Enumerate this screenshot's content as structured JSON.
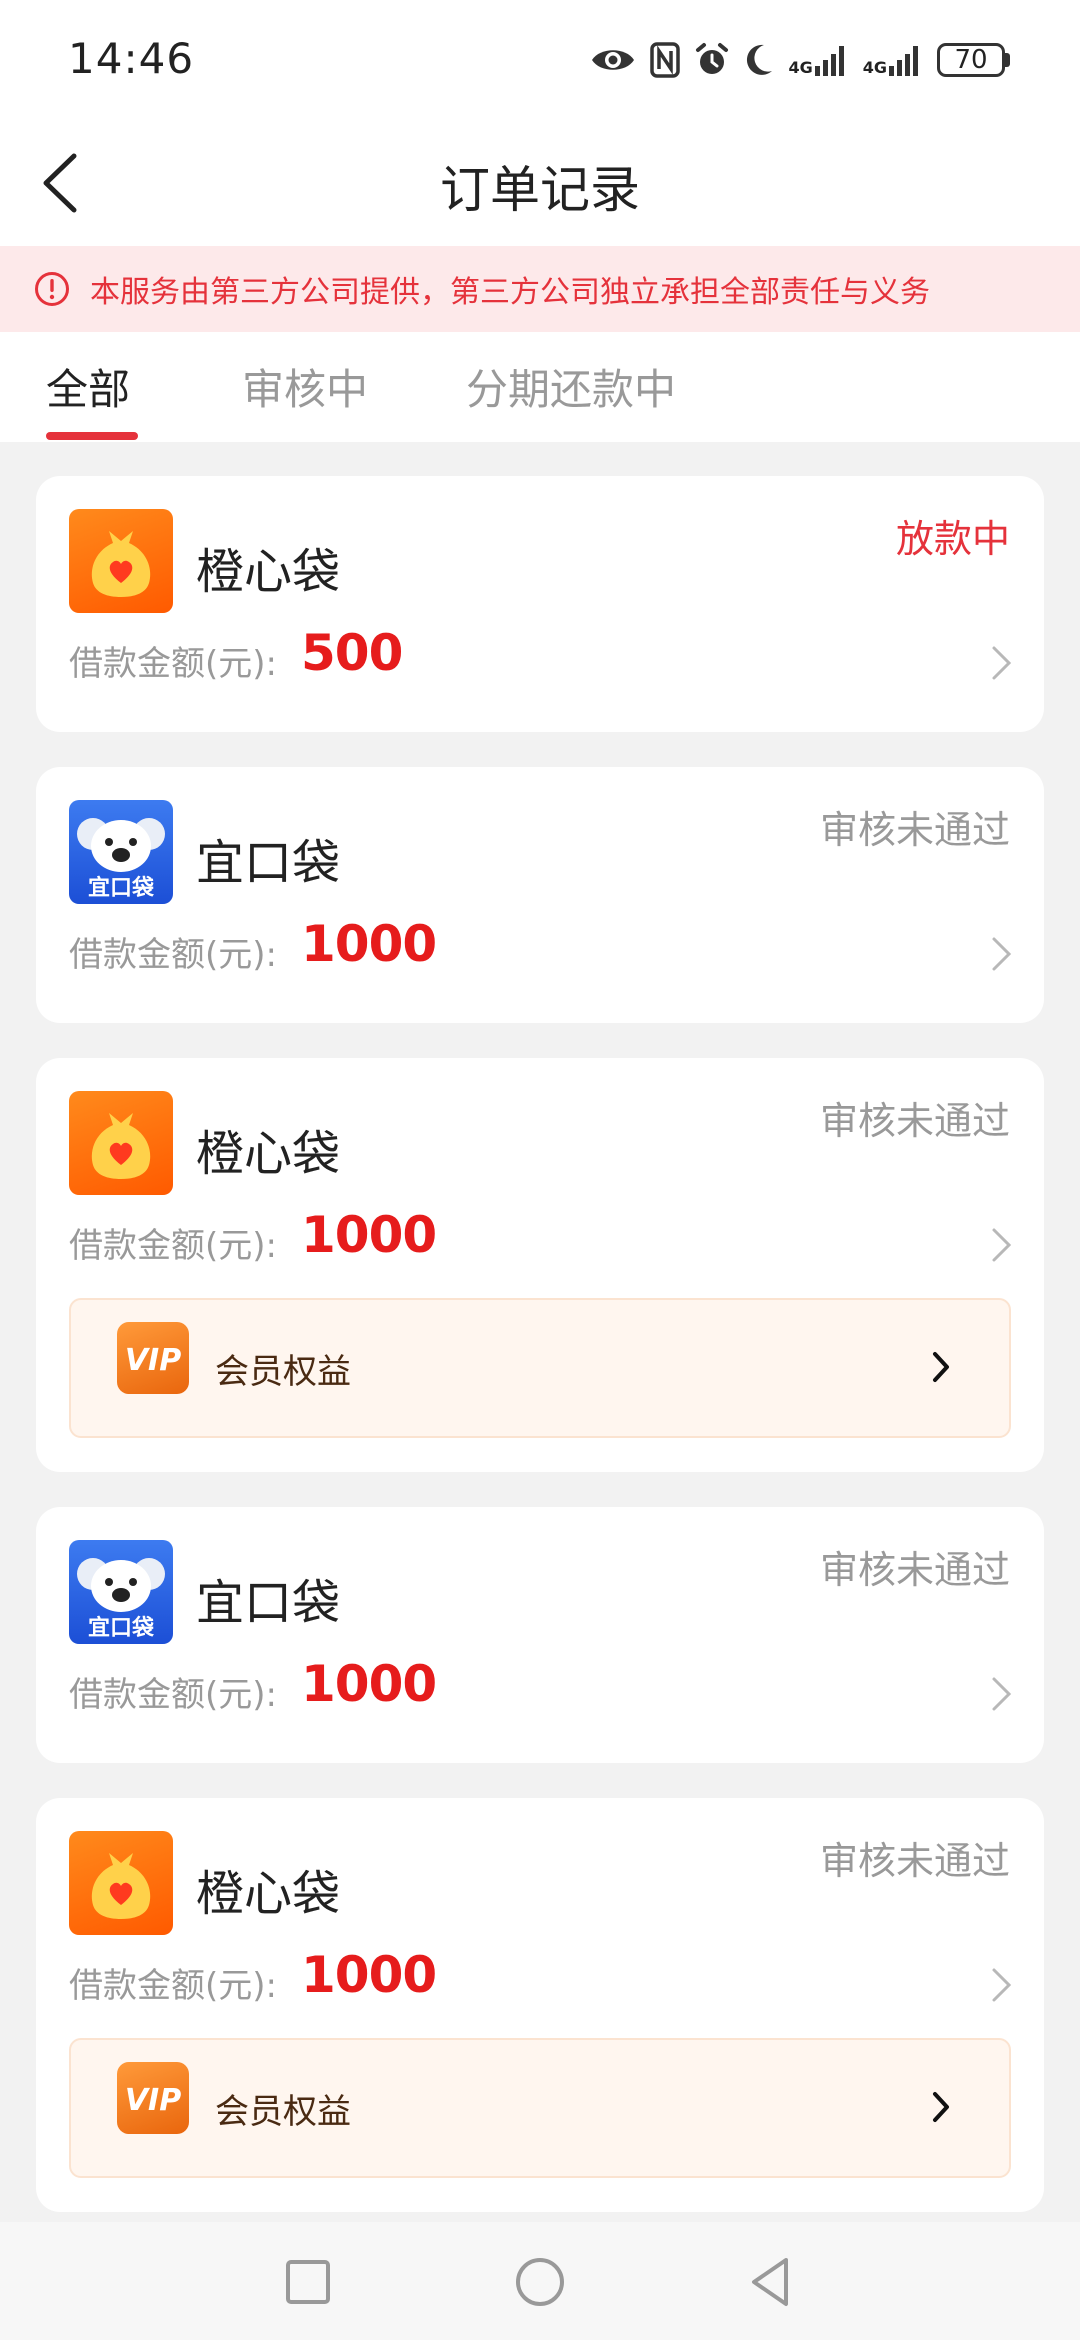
{
  "status_bar": {
    "time": "14:46",
    "network_1": "4G",
    "network_2": "4G",
    "battery": "70"
  },
  "header": {
    "title": "订单记录"
  },
  "notice": {
    "text": "本服务由第三方公司提供，第三方公司独立承担全部责任与义务"
  },
  "tabs": [
    {
      "label": "全部"
    },
    {
      "label": "审核中"
    },
    {
      "label": "分期还款中"
    }
  ],
  "orders": [
    {
      "brand": "橙心袋",
      "status": "放款中",
      "amount_label": "借款金额(元):",
      "amount": "500"
    },
    {
      "brand": "宜口袋",
      "status": "审核未通过",
      "amount_label": "借款金额(元):",
      "amount": "1000"
    },
    {
      "brand": "橙心袋",
      "status": "审核未通过",
      "amount_label": "借款金额(元):",
      "amount": "1000",
      "vip_label": "会员权益"
    },
    {
      "brand": "宜口袋",
      "status": "审核未通过",
      "amount_label": "借款金额(元):",
      "amount": "1000"
    },
    {
      "brand": "橙心袋",
      "status": "审核未通过",
      "amount_label": "借款金额(元):",
      "amount": "1000",
      "vip_label": "会员权益"
    }
  ],
  "logos": {
    "yikoudai_text": "宜口袋",
    "vip_text": "VIP"
  },
  "colors": {
    "accent": "#e5323b",
    "amount": "#e61c1c",
    "notice_bg": "#fde9ea",
    "orange_logo": "#ff6a00",
    "blue_logo": "#2a5fe0"
  }
}
